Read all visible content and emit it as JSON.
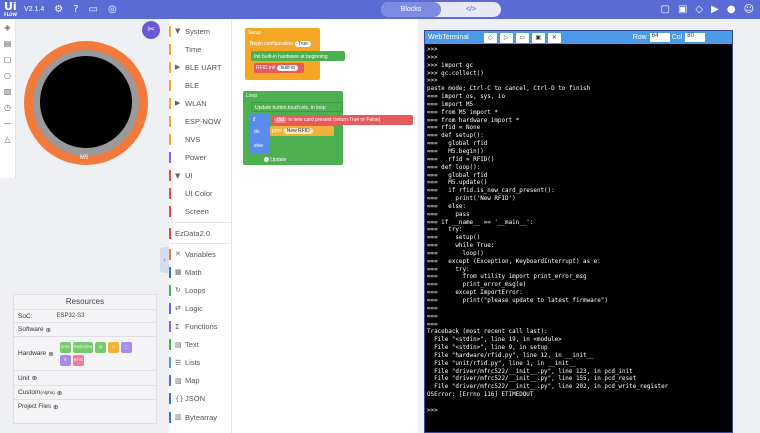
{
  "app": {
    "logo_main": "Ui",
    "logo_sub": "FLOW",
    "version": "V2.1.4",
    "mode_tabs": [
      "Blocks",
      "</>"
    ]
  },
  "categories": [
    {
      "label": "System",
      "color": "#f0a830",
      "glyph": "▼"
    },
    {
      "label": "Time",
      "color": "#f0a830",
      "glyph": ""
    },
    {
      "label": "BLE UART",
      "color": "#f0a830",
      "glyph": "▶"
    },
    {
      "label": "BLE",
      "color": "#f0a830",
      "glyph": ""
    },
    {
      "label": "WLAN",
      "color": "#f0a830",
      "glyph": "▶"
    },
    {
      "label": "ESP-NOW",
      "color": "#f0a830",
      "glyph": ""
    },
    {
      "label": "NVS",
      "color": "#f0a830",
      "glyph": ""
    },
    {
      "label": "Power",
      "color": "#8a63d2",
      "glyph": ""
    },
    {
      "label": "UI",
      "color": "#e04a4a",
      "glyph": "▼"
    },
    {
      "label": "UI Color",
      "color": "#e04a4a",
      "glyph": ""
    },
    {
      "label": "Screen",
      "color": "#e04a4a",
      "glyph": ""
    },
    {
      "label": "EzData2.0",
      "color": "#e04a4a",
      "glyph": ""
    },
    {
      "label": "Variables",
      "color": "#e07b3c",
      "glyph": "✕"
    },
    {
      "label": "Math",
      "color": "#3b6fd6",
      "glyph": "▦"
    },
    {
      "label": "Loops",
      "color": "#4caf50",
      "glyph": "↻"
    },
    {
      "label": "Logic",
      "color": "#5b6bd6",
      "glyph": "⇄"
    },
    {
      "label": "Functions",
      "color": "#8a63d2",
      "glyph": "Σ"
    },
    {
      "label": "Text",
      "color": "#4caf50",
      "glyph": "▤"
    },
    {
      "label": "Lists",
      "color": "#4a9ae8",
      "glyph": "☰"
    },
    {
      "label": "Map",
      "color": "#5b6bd6",
      "glyph": "▧"
    },
    {
      "label": "JSON",
      "color": "#3b6fd6",
      "glyph": "{}"
    },
    {
      "label": "Bytearray",
      "color": "#3b6fd6",
      "glyph": "▥"
    }
  ],
  "device": {
    "label": "M5"
  },
  "resources": {
    "title": "Resources",
    "soc_label": "SoC:",
    "soc_value": "ESP32-S3",
    "software_label": "Software",
    "hardware_label": "Hardware",
    "hardware_badges": [
      {
        "text": "BTN",
        "color": "#7bc96f"
      },
      {
        "text": "PWR BTN",
        "color": "#7bc96f"
      },
      {
        "text": "◎",
        "color": "#7bc96f"
      },
      {
        "text": "☺",
        "color": "#f2b23a"
      },
      {
        "text": "⬚",
        "color": "#a88ae8"
      },
      {
        "text": "R",
        "color": "#a88ae8"
      },
      {
        "text": "RFID",
        "color": "#f27aa0"
      }
    ],
    "unit_label": "Unit",
    "custom_label": "Custom",
    "custom_tag": "(Alpha)",
    "project_files_label": "Project Files"
  },
  "workspace": {
    "setup_label": "Setup",
    "begin_config": "Begin configuration",
    "begin_value": "True",
    "init_builtin": "Init built-in hardware at beginning",
    "rfid_init": "RFID init",
    "rfid_init_value": "built-in",
    "loop_label": "Loop",
    "update_button": "Update button,touch,etc. in loop",
    "if_label": "if",
    "rfid_var": "rfid",
    "new_card_label": "is new card present (return True or False)",
    "do_label": "do",
    "print_label": "print",
    "new_rfid": "New RFID",
    "else_label": "else",
    "update_label": "Update"
  },
  "terminal": {
    "title": "WebTerminal",
    "row_label": "Row",
    "row_value": "64",
    "col_label": "Col",
    "col_value": "80",
    "lines": [
      ">>>",
      ">>>",
      ">>> import gc",
      ">>> gc.collect()",
      ">>>",
      "paste mode; Ctrl-C to cancel, Ctrl-D to finish",
      "=== import os, sys, io",
      "=== import M5",
      "=== from M5 import *",
      "=== from hardware import *",
      "=== rfid = None",
      "=== def setup():",
      "===   global rfid",
      "===   M5.begin()",
      "===   rfid = RFID()",
      "=== def loop():",
      "===   global rfid",
      "===   M5.update()",
      "===   if rfid.is_new_card_present():",
      "===     print('New RFID')",
      "===   else:",
      "===     pass",
      "=== if __name__ == '__main__':",
      "===   try:",
      "===     setup()",
      "===     while True:",
      "===       loop()",
      "===   except (Exception, KeyboardInterrupt) as e:",
      "===     try:",
      "===       from utility import print_error_msg",
      "===       print_error_msg(e)",
      "===     except ImportError:",
      "===       print(\"please update to latest firmware\")",
      "===",
      "===",
      "===",
      "Traceback (most recent call last):",
      "  File \"<stdin>\", line 19, in <module>",
      "  File \"<stdin>\", line 9, in setup",
      "  File \"hardware/rfid.py\", line 12, in __init__",
      "  File \"unit/rfid.py\", line 1, in __init__",
      "  File \"driver/mfrc522/__init__.py\", line 123, in pcd_init",
      "  File \"driver/mfrc522/__init__.py\", line 155, in pcd_reset",
      "  File \"driver/mfrc522/__init__.py\", line 202, in pcd_write_register",
      "OSError: [Errno 116] ETIMEDOUT",
      "",
      ">>>"
    ]
  }
}
